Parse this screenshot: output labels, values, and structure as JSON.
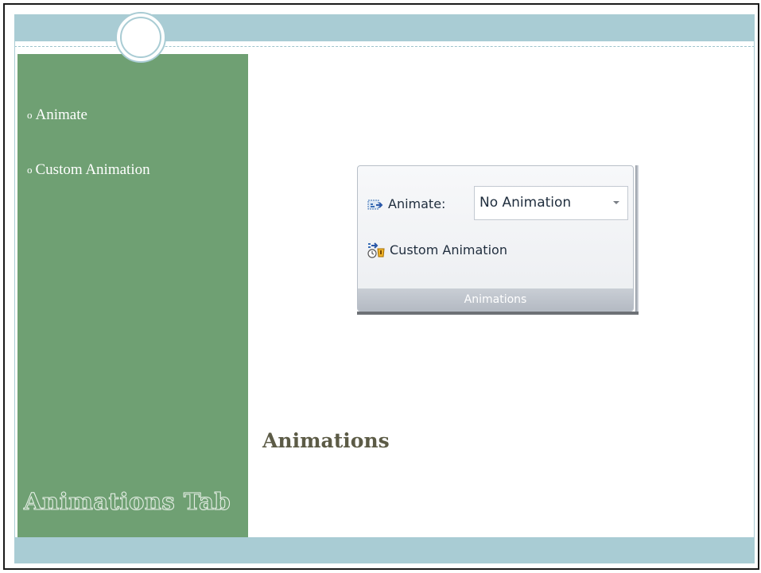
{
  "sidebar": {
    "bullets": [
      "Animate",
      "Custom Animation"
    ],
    "bullet_glyph": "o",
    "title": "Animations Tab"
  },
  "main": {
    "title": "Animations"
  },
  "ribbon": {
    "animate_label": "Animate:",
    "animate_value": "No Animation",
    "custom_animation_label": "Custom Animation",
    "group_label": "Animations",
    "icons": {
      "animate": "animate-icon",
      "custom_animation": "custom-animation-icon",
      "dropdown": "chevron-down-icon"
    }
  },
  "colors": {
    "sidebar_green": "#6fa073",
    "band_blue": "#a9ccd4",
    "title_olive": "#5c5b46"
  }
}
